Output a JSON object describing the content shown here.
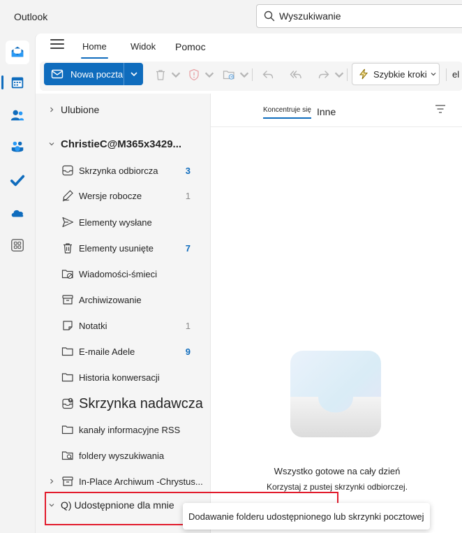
{
  "app": {
    "title": "Outlook"
  },
  "search": {
    "placeholder": "Wyszukiwanie"
  },
  "rail": {
    "items": [
      {
        "name": "mail",
        "icon": "mail-icon"
      },
      {
        "name": "calendar",
        "icon": "calendar-icon"
      },
      {
        "name": "people",
        "icon": "people-icon"
      },
      {
        "name": "teams",
        "icon": "teams-icon"
      },
      {
        "name": "todo",
        "icon": "checkmark-icon"
      },
      {
        "name": "onedrive",
        "icon": "cloud-icon"
      },
      {
        "name": "apps",
        "icon": "apps-icon"
      }
    ]
  },
  "ribbon": {
    "tabs": [
      {
        "label": "Home"
      },
      {
        "label": "Widok"
      },
      {
        "label": "Pomoc"
      }
    ]
  },
  "toolbar": {
    "new_mail_label": "Nowa poczta",
    "quick_steps_label": "Szybkie kroki",
    "overflow_text": "el"
  },
  "folders": {
    "favorites_label": "Ulubione",
    "account_label": "ChristieC@M365x3429...",
    "items": [
      {
        "label": "Skrzynka odbiorcza",
        "count": "3",
        "icon": "inbox-icon"
      },
      {
        "label": "Wersje robocze",
        "count": "1",
        "icon": "draft-icon"
      },
      {
        "label": "Elementy wysłane",
        "count": "",
        "icon": "send-icon"
      },
      {
        "label": "Elementy usunięte",
        "count": "7",
        "icon": "trash-icon"
      },
      {
        "label": "Wiadomości-śmieci",
        "count": "",
        "icon": "junk-icon"
      },
      {
        "label": "Archiwizowanie",
        "count": "",
        "icon": "archive-icon"
      },
      {
        "label": "Notatki",
        "count": "1",
        "icon": "note-icon"
      },
      {
        "label": "E-maile Adele",
        "count": "9",
        "icon": "folder-icon"
      },
      {
        "label": "Historia konwersacji",
        "count": "",
        "icon": "folder-icon"
      },
      {
        "label": "Skrzynka nadawcza",
        "count": "",
        "icon": "outbox-icon"
      },
      {
        "label": "kanały informacyjne RSS",
        "count": "",
        "icon": "folder-icon"
      },
      {
        "label": "foldery wyszukiwania",
        "count": "",
        "icon": "search-folder-icon"
      }
    ],
    "archive_label": "In-Place Archiwum -Chrystus...",
    "shared_label": "Q) Udostępnione dla mnie"
  },
  "message_list": {
    "focused_label": "Koncentruje się",
    "other_label": "Inne"
  },
  "empty_state": {
    "title": "Wszystko gotowe na cały dzień",
    "subtitle": "Korzystaj z pustej skrzynki odbiorczej."
  },
  "tooltip": {
    "text": "Dodawanie folderu udostępnionego lub skrzynki pocztowej"
  },
  "colors": {
    "accent": "#0f6cbd",
    "highlight": "#e21b2c"
  }
}
